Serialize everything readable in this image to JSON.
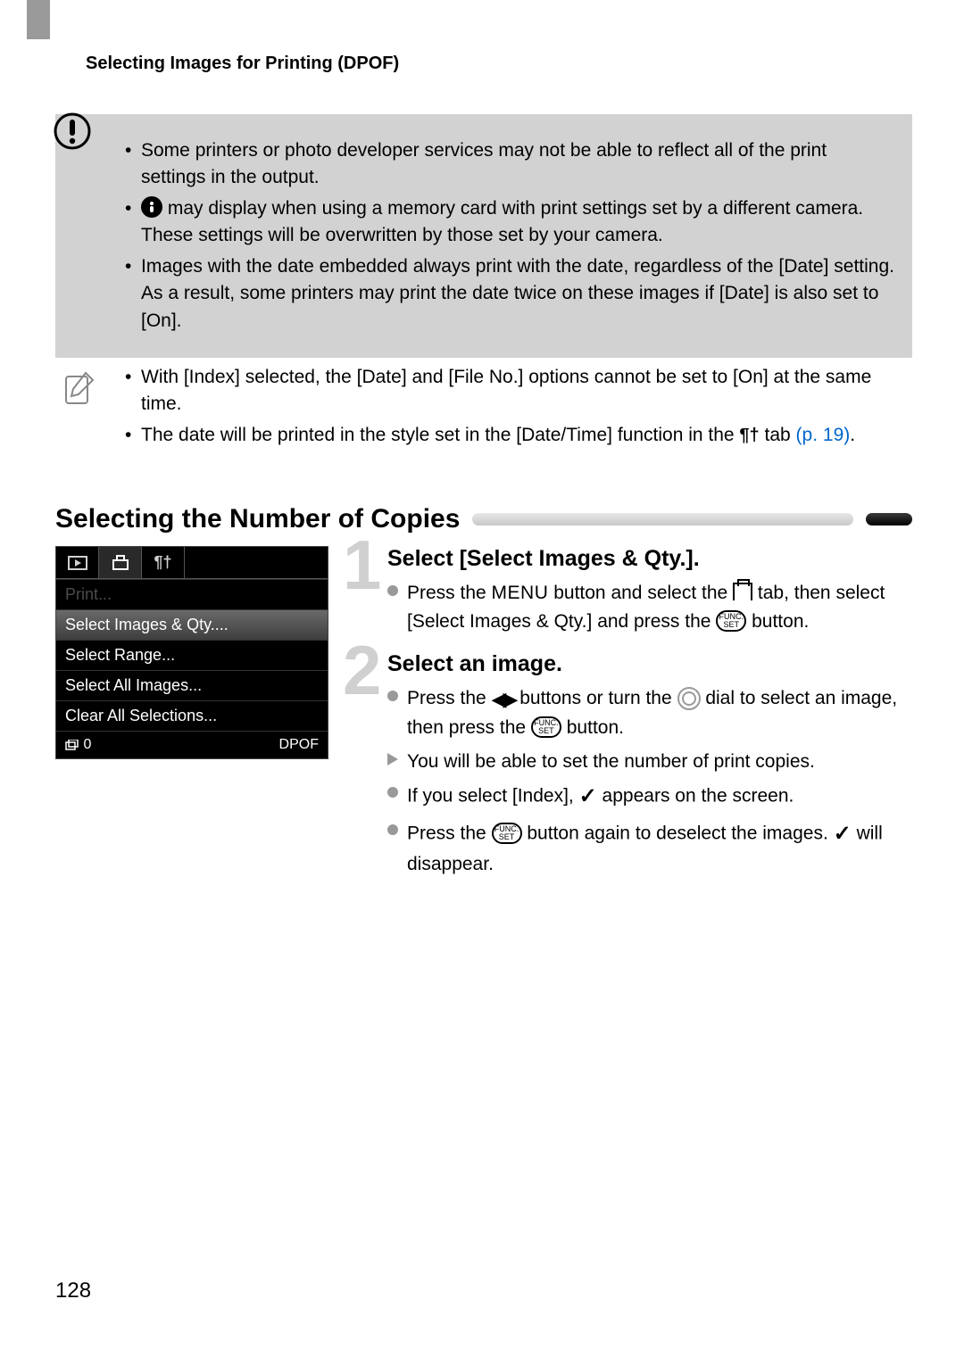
{
  "header": {
    "title": "Selecting Images for Printing (DPOF)"
  },
  "warning": {
    "items": [
      "Some printers or photo developer services may not be able to reflect all of the print settings in the output.",
      "may display when using a memory card with print settings set by a different camera. These settings will be overwritten by those set by your camera.",
      "Images with the date embedded always print with the date, regardless of the [Date] setting. As a result, some printers may print the date twice on these images if [Date] is also set to [On]."
    ]
  },
  "note": {
    "item1": "With [Index] selected, the [Date] and [File No.] options cannot be set to [On] at the same time.",
    "item2_pre": "The date will be printed in the style set in the [Date/Time] function in the ",
    "item2_tab": " tab ",
    "item2_link": "(p. 19)",
    "item2_post": "."
  },
  "section": {
    "title": "Selecting the Number of Copies"
  },
  "camera": {
    "row_print": "Print...",
    "row_select": "Select Images & Qty....",
    "row_range": "Select Range...",
    "row_all": "Select All Images...",
    "row_clear": "Clear All Selections...",
    "footer_left": "0",
    "footer_right": "DPOF"
  },
  "steps": {
    "s1": {
      "num": "1",
      "title": "Select [Select Images & Qty.].",
      "p1_a": "Press the ",
      "p1_menu": "MENU",
      "p1_b": " button and select the ",
      "p1_c": " tab, then select [Select Images & Qty.] and press the ",
      "p1_d": " button."
    },
    "s2": {
      "num": "2",
      "title": "Select an image.",
      "p1_a": "Press the ",
      "p1_b": " buttons or turn the ",
      "p1_c": " dial to select an image, then press the ",
      "p1_d": " button.",
      "p2": "You will be able to set the number of print copies.",
      "p3_a": "If you select [Index], ",
      "p3_b": " appears on the screen.",
      "p4_a": "Press the ",
      "p4_b": " button again to deselect the images. ",
      "p4_c": " will disappear."
    }
  },
  "funcset": "FUNC.\nSET",
  "page": "128"
}
